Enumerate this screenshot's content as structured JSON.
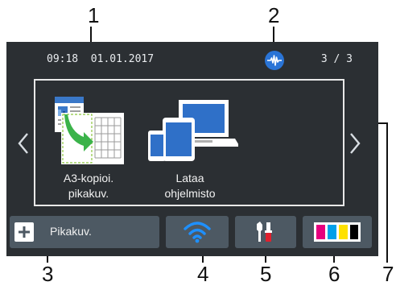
{
  "callouts": {
    "c1": "1",
    "c2": "2",
    "c3": "3",
    "c4": "4",
    "c5": "5",
    "c6": "6",
    "c7": "7"
  },
  "status_bar": {
    "time_date": "09:18  01.01.2017",
    "page_indicator": "3 / 3",
    "status_icon": "wireless-signal-icon"
  },
  "shortcuts": {
    "a3_copy_line1": "A3-kopioi.",
    "a3_copy_line2": "pikakuv.",
    "download_line1": "Lataa",
    "download_line2": "ohjelmisto"
  },
  "bottom_bar": {
    "pikakuv_label": "Pikakuv.",
    "plus_icon": "plus-icon",
    "wifi_icon": "wifi-icon",
    "settings_icon": "tools-settings-icon",
    "ink_icon": "ink-levels-icon"
  },
  "colors": {
    "screen_bg": "#2b2f33",
    "button_bg": "#4d5963",
    "ink_magenta": "#e6007e",
    "ink_cyan": "#00a0e9",
    "ink_yellow": "#ffe100",
    "ink_black": "#000000"
  }
}
